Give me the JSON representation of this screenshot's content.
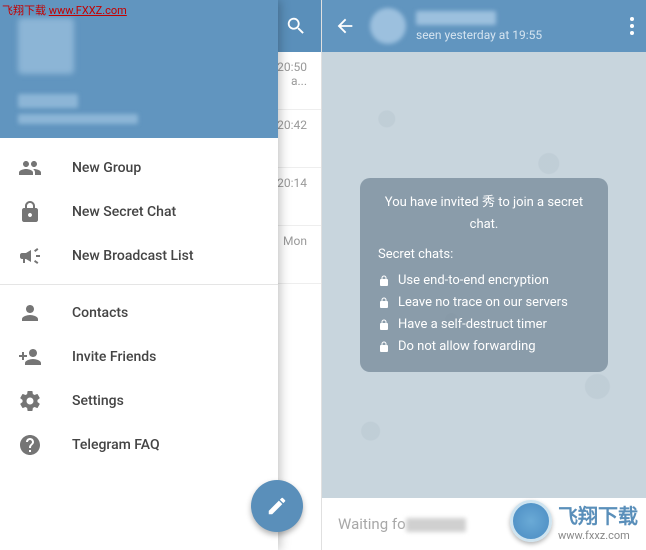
{
  "watermark": {
    "top_label": "飞翔下载",
    "top_url": "www.FXXZ.com",
    "bottom_cn": "飞翔下载",
    "bottom_url": "www.fxxz.com"
  },
  "drawer": {
    "items": [
      {
        "icon": "group-icon",
        "label": "New Group"
      },
      {
        "icon": "lock-icon",
        "label": "New Secret Chat"
      },
      {
        "icon": "megaphone-icon",
        "label": "New Broadcast List"
      }
    ],
    "items2": [
      {
        "icon": "person-icon",
        "label": "Contacts"
      },
      {
        "icon": "person-add-icon",
        "label": "Invite Friends"
      },
      {
        "icon": "gear-icon",
        "label": "Settings"
      },
      {
        "icon": "help-icon",
        "label": "Telegram FAQ"
      }
    ]
  },
  "chat_list": {
    "rows": [
      {
        "time": "20:50",
        "preview": "a..."
      },
      {
        "time": "20:42",
        "preview": ""
      },
      {
        "time": "20:14",
        "preview": ""
      },
      {
        "time": "Mon",
        "preview": ""
      }
    ]
  },
  "chat_header": {
    "subtitle_prefix": "seen yesterday at",
    "subtitle_time": "19:55"
  },
  "secret_chat_info": {
    "invite_text": "You have invited 秀 to join a secret chat.",
    "heading": "Secret chats:",
    "features": [
      "Use end-to-end encryption",
      "Leave no trace on our servers",
      "Have a self-destruct timer",
      "Do not allow forwarding"
    ]
  },
  "input_bar": {
    "waiting_prefix": "Waiting fo"
  }
}
